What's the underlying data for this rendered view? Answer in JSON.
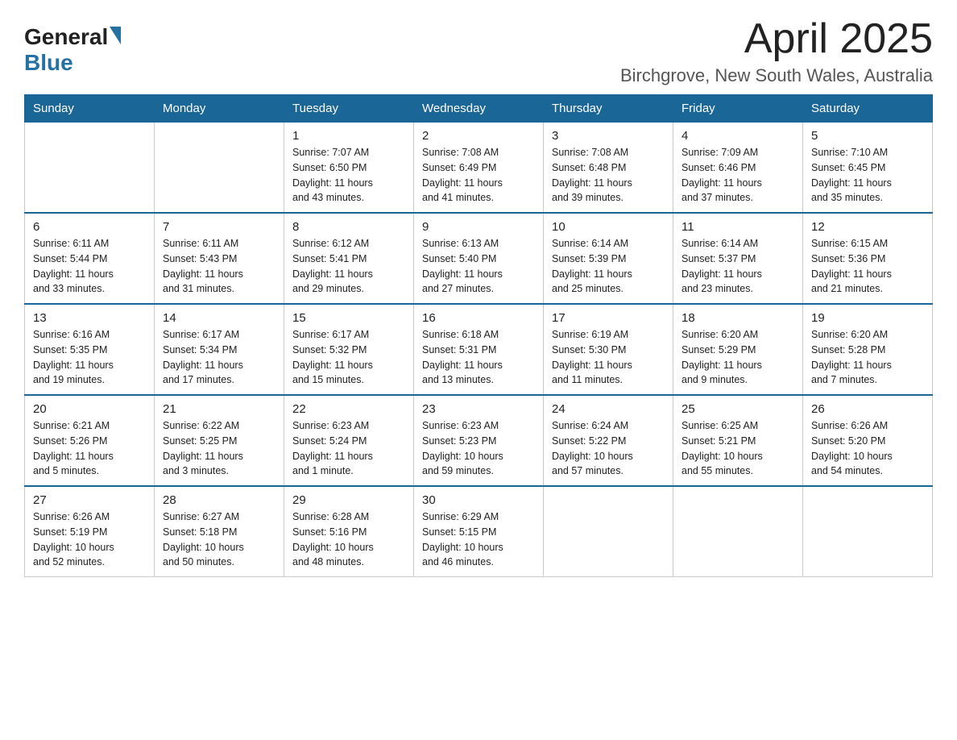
{
  "header": {
    "logo_general": "General",
    "logo_blue": "Blue",
    "month_title": "April 2025",
    "location": "Birchgrove, New South Wales, Australia"
  },
  "days_of_week": [
    "Sunday",
    "Monday",
    "Tuesday",
    "Wednesday",
    "Thursday",
    "Friday",
    "Saturday"
  ],
  "weeks": [
    [
      {
        "day": "",
        "info": ""
      },
      {
        "day": "",
        "info": ""
      },
      {
        "day": "1",
        "info": "Sunrise: 7:07 AM\nSunset: 6:50 PM\nDaylight: 11 hours\nand 43 minutes."
      },
      {
        "day": "2",
        "info": "Sunrise: 7:08 AM\nSunset: 6:49 PM\nDaylight: 11 hours\nand 41 minutes."
      },
      {
        "day": "3",
        "info": "Sunrise: 7:08 AM\nSunset: 6:48 PM\nDaylight: 11 hours\nand 39 minutes."
      },
      {
        "day": "4",
        "info": "Sunrise: 7:09 AM\nSunset: 6:46 PM\nDaylight: 11 hours\nand 37 minutes."
      },
      {
        "day": "5",
        "info": "Sunrise: 7:10 AM\nSunset: 6:45 PM\nDaylight: 11 hours\nand 35 minutes."
      }
    ],
    [
      {
        "day": "6",
        "info": "Sunrise: 6:11 AM\nSunset: 5:44 PM\nDaylight: 11 hours\nand 33 minutes."
      },
      {
        "day": "7",
        "info": "Sunrise: 6:11 AM\nSunset: 5:43 PM\nDaylight: 11 hours\nand 31 minutes."
      },
      {
        "day": "8",
        "info": "Sunrise: 6:12 AM\nSunset: 5:41 PM\nDaylight: 11 hours\nand 29 minutes."
      },
      {
        "day": "9",
        "info": "Sunrise: 6:13 AM\nSunset: 5:40 PM\nDaylight: 11 hours\nand 27 minutes."
      },
      {
        "day": "10",
        "info": "Sunrise: 6:14 AM\nSunset: 5:39 PM\nDaylight: 11 hours\nand 25 minutes."
      },
      {
        "day": "11",
        "info": "Sunrise: 6:14 AM\nSunset: 5:37 PM\nDaylight: 11 hours\nand 23 minutes."
      },
      {
        "day": "12",
        "info": "Sunrise: 6:15 AM\nSunset: 5:36 PM\nDaylight: 11 hours\nand 21 minutes."
      }
    ],
    [
      {
        "day": "13",
        "info": "Sunrise: 6:16 AM\nSunset: 5:35 PM\nDaylight: 11 hours\nand 19 minutes."
      },
      {
        "day": "14",
        "info": "Sunrise: 6:17 AM\nSunset: 5:34 PM\nDaylight: 11 hours\nand 17 minutes."
      },
      {
        "day": "15",
        "info": "Sunrise: 6:17 AM\nSunset: 5:32 PM\nDaylight: 11 hours\nand 15 minutes."
      },
      {
        "day": "16",
        "info": "Sunrise: 6:18 AM\nSunset: 5:31 PM\nDaylight: 11 hours\nand 13 minutes."
      },
      {
        "day": "17",
        "info": "Sunrise: 6:19 AM\nSunset: 5:30 PM\nDaylight: 11 hours\nand 11 minutes."
      },
      {
        "day": "18",
        "info": "Sunrise: 6:20 AM\nSunset: 5:29 PM\nDaylight: 11 hours\nand 9 minutes."
      },
      {
        "day": "19",
        "info": "Sunrise: 6:20 AM\nSunset: 5:28 PM\nDaylight: 11 hours\nand 7 minutes."
      }
    ],
    [
      {
        "day": "20",
        "info": "Sunrise: 6:21 AM\nSunset: 5:26 PM\nDaylight: 11 hours\nand 5 minutes."
      },
      {
        "day": "21",
        "info": "Sunrise: 6:22 AM\nSunset: 5:25 PM\nDaylight: 11 hours\nand 3 minutes."
      },
      {
        "day": "22",
        "info": "Sunrise: 6:23 AM\nSunset: 5:24 PM\nDaylight: 11 hours\nand 1 minute."
      },
      {
        "day": "23",
        "info": "Sunrise: 6:23 AM\nSunset: 5:23 PM\nDaylight: 10 hours\nand 59 minutes."
      },
      {
        "day": "24",
        "info": "Sunrise: 6:24 AM\nSunset: 5:22 PM\nDaylight: 10 hours\nand 57 minutes."
      },
      {
        "day": "25",
        "info": "Sunrise: 6:25 AM\nSunset: 5:21 PM\nDaylight: 10 hours\nand 55 minutes."
      },
      {
        "day": "26",
        "info": "Sunrise: 6:26 AM\nSunset: 5:20 PM\nDaylight: 10 hours\nand 54 minutes."
      }
    ],
    [
      {
        "day": "27",
        "info": "Sunrise: 6:26 AM\nSunset: 5:19 PM\nDaylight: 10 hours\nand 52 minutes."
      },
      {
        "day": "28",
        "info": "Sunrise: 6:27 AM\nSunset: 5:18 PM\nDaylight: 10 hours\nand 50 minutes."
      },
      {
        "day": "29",
        "info": "Sunrise: 6:28 AM\nSunset: 5:16 PM\nDaylight: 10 hours\nand 48 minutes."
      },
      {
        "day": "30",
        "info": "Sunrise: 6:29 AM\nSunset: 5:15 PM\nDaylight: 10 hours\nand 46 minutes."
      },
      {
        "day": "",
        "info": ""
      },
      {
        "day": "",
        "info": ""
      },
      {
        "day": "",
        "info": ""
      }
    ]
  ]
}
